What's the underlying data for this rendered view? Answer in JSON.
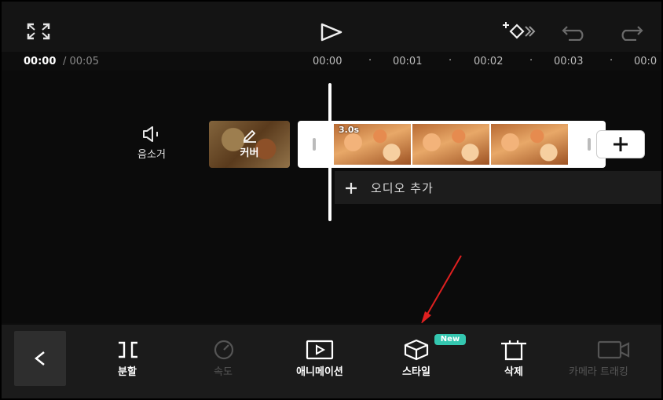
{
  "toolbar": {
    "fullscreen_icon": "fullscreen-icon",
    "play_icon": "play-icon",
    "keyframe_icon": "keyframe-add-icon",
    "undo_icon": "undo-icon",
    "redo_icon": "redo-icon"
  },
  "time": {
    "current": "00:00",
    "total": "/ 00:05",
    "ruler": [
      "00:00",
      "00:01",
      "00:02",
      "00:03",
      "00:0"
    ]
  },
  "timeline": {
    "mute_label": "음소거",
    "cover_label": "커버",
    "clip_duration": "3.0s",
    "add_audio_label": "오디오 추가"
  },
  "bottom_tools": [
    {
      "label": "분할",
      "icon": "split-icon",
      "enabled": true
    },
    {
      "label": "속도",
      "icon": "speed-icon",
      "enabled": false
    },
    {
      "label": "애니메이션",
      "icon": "animation-icon",
      "enabled": true
    },
    {
      "label": "스타일",
      "icon": "style-icon",
      "enabled": true,
      "badge": "New"
    },
    {
      "label": "삭제",
      "icon": "delete-icon",
      "enabled": true
    },
    {
      "label": "카메라 트래킹",
      "icon": "camera-tracking-icon",
      "enabled": false
    }
  ],
  "colors": {
    "badge": "#34c7b0",
    "annotation_arrow": "#e02020"
  }
}
